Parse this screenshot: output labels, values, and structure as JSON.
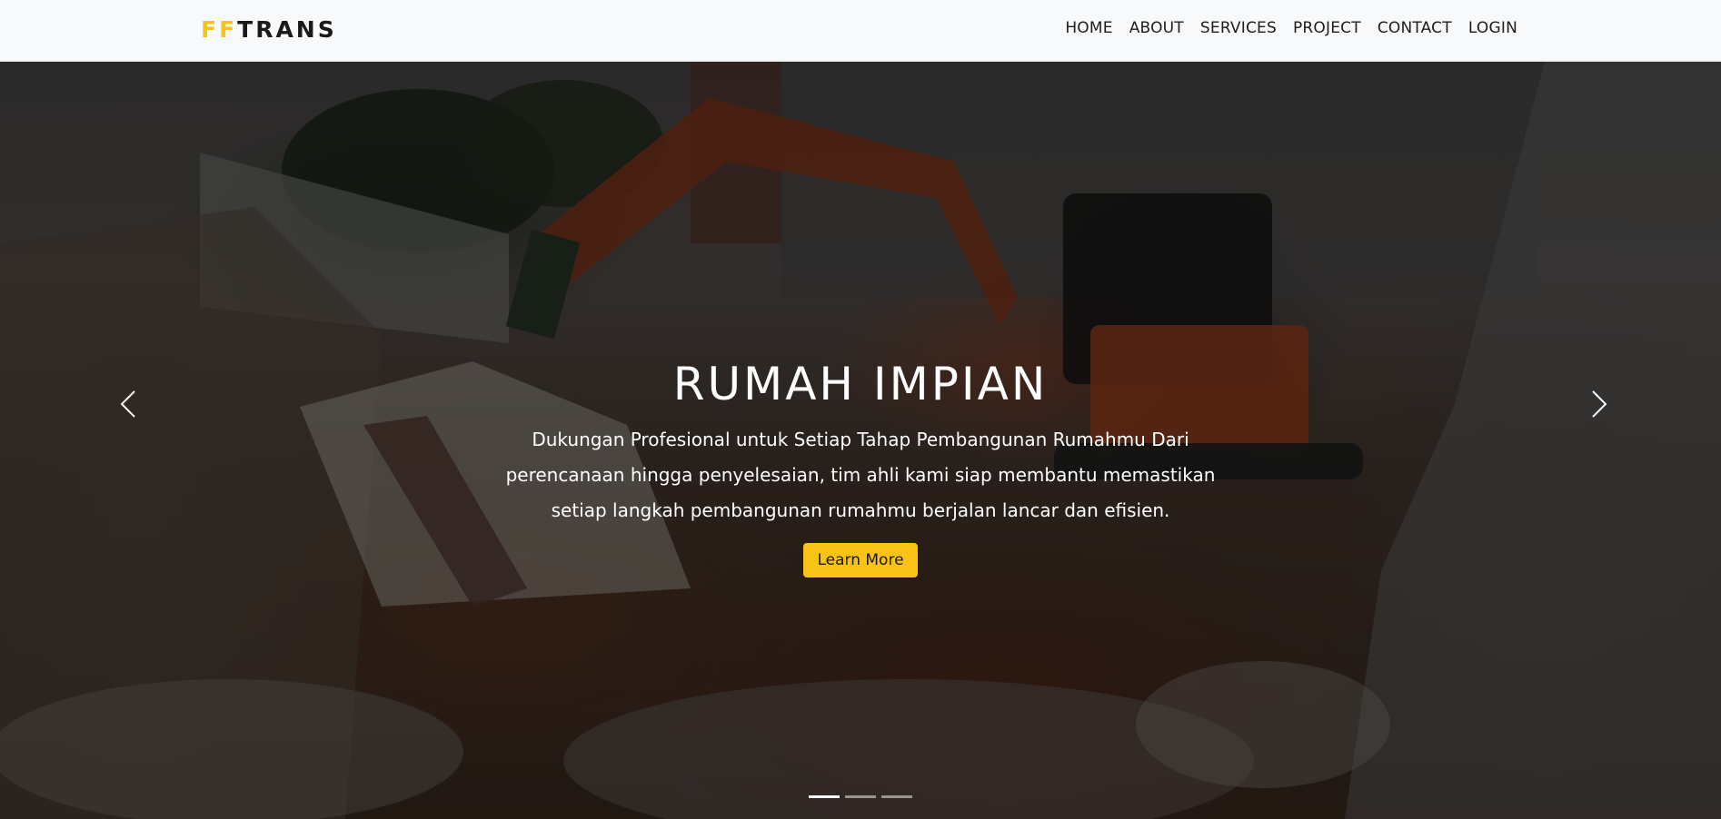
{
  "brand": {
    "accent": "FF",
    "rest": "TRANS"
  },
  "nav": {
    "items": [
      {
        "label": "HOME"
      },
      {
        "label": "ABOUT"
      },
      {
        "label": "SERVICES"
      },
      {
        "label": "PROJECT"
      },
      {
        "label": "CONTACT"
      },
      {
        "label": "LOGIN"
      }
    ]
  },
  "hero": {
    "title": "RUMAH IMPIAN",
    "lines": [
      "Dukungan Profesional untuk Setiap Tahap Pembangunan Rumahmu Dari",
      "perencanaan hingga penyelesaian, tim ahli kami siap membantu memastikan",
      "setiap langkah pembangunan rumahmu berjalan lancar dan efisien."
    ],
    "button_label": "Learn More",
    "active_slide": 1,
    "slide_count": 3
  },
  "icons": {
    "prev": "chevron-left-icon",
    "next": "chevron-right-icon"
  },
  "colors": {
    "accent": "#f8c315",
    "navbar_bg": "#f8f9fa",
    "text_dark": "#1d1d1d"
  }
}
